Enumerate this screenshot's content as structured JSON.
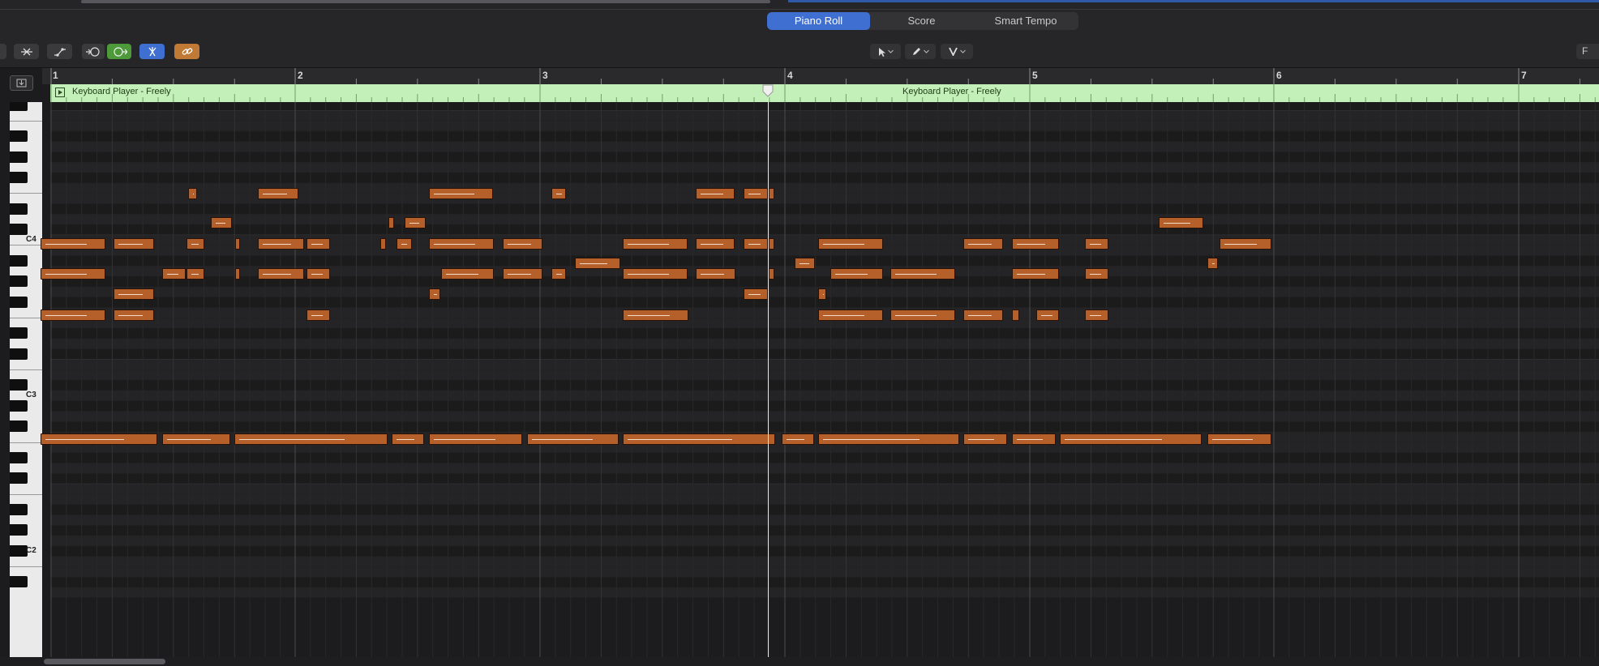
{
  "tabs": {
    "piano_roll": "Piano Roll",
    "score": "Score",
    "smart_tempo": "Smart Tempo"
  },
  "toolbar": {
    "right_label": "F"
  },
  "ruler": {
    "bars": [
      "1",
      "2",
      "3",
      "4",
      "5",
      "6",
      "7"
    ]
  },
  "region": {
    "label_left": "Keyboard Player - Freely",
    "label_right": "Keyboard Player - Freely"
  },
  "keyboard": {
    "c4": "C4",
    "c3": "C3",
    "c2": "C2"
  },
  "colors": {
    "note": "#b5602a",
    "region": "#c3f0b9",
    "active_tab": "#3e6fd1",
    "accent_button": "#c07a35",
    "blue_button": "#3e6fd1"
  },
  "icons": [
    "midi-in-icon",
    "quantize-icon",
    "automation-icon",
    "midi-thru-icon",
    "midi-out-icon",
    "scissors-icon",
    "link-icon",
    "pointer-tool-icon",
    "pencil-tool-icon",
    "velocity-tool-icon"
  ]
}
